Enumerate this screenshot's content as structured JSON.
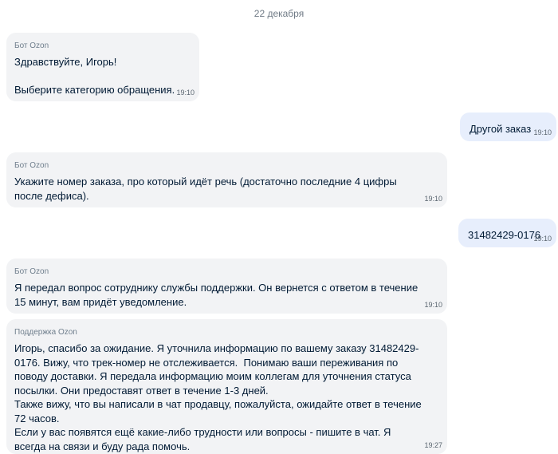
{
  "chat": {
    "date": "22 декабря",
    "messages": [
      {
        "sender": "Бот Ozon",
        "text": "Здравствуйте, Игорь!\n\nВыберите категорию обращения.",
        "time": "19:10"
      },
      {
        "text": "Другой заказ",
        "time": "19:10"
      },
      {
        "sender": "Бот Ozon",
        "text": "Укажите номер заказа, про который идёт речь (достаточно последние 4 цифры\nпосле дефиса).",
        "time": "19:10"
      },
      {
        "text": "31482429-0176",
        "time": "19:10"
      },
      {
        "sender": "Бот Ozon",
        "text": "Я передал вопрос сотруднику службы поддержки. Он вернется с ответом в течение\n15 минут, вам придёт уведомление.",
        "time": "19:10"
      },
      {
        "sender": "Поддержка Ozon",
        "text": "Игорь, спасибо за ожидание. Я уточнила информацию по вашему заказу 31482429-\n0176. Вижу, что трек-номер не отслеживается.  Понимаю ваши переживания по\nповоду доставки. Я передала информацию моим коллегам для уточнения статуса\nпосылки. Они предоставят ответ в течение 1-3 дней.\nТакже вижу, что вы написали в чат продавцу, пожалуйста, ожидайте ответ в течение\n72 часов.\nЕсли у вас появятся ещё какие-либо трудности или вопросы - пишите в чат. Я\nвсегда на связи и буду рада помочь.",
        "time": "19:27"
      }
    ]
  }
}
